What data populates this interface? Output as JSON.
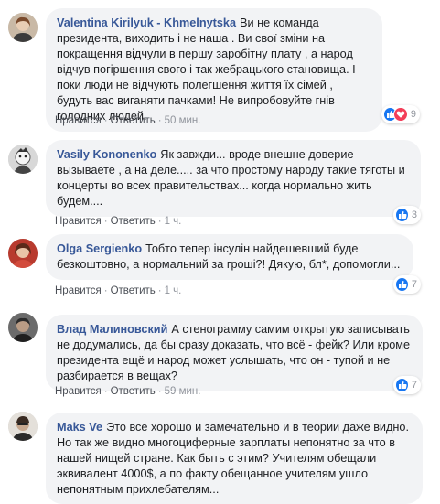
{
  "comments": [
    {
      "author": "Valentina Kirilyuk - Khmelnytska",
      "text": "Ви не команда президента, виходить і не наша . Ви свої зміни на покращення відчули в першу заробітну плату , а народ відчув погіршення свого і так жебрацького становища. І поки люди не відчують полегшення життя їх сімей , будуть вас виганяти пачками! Не випробовуйте гнів голодних людей.",
      "like_label": "Нравится",
      "reply_label": "Ответить",
      "time": "50 мин.",
      "reaction_count": "9",
      "reactions": [
        "like-icon",
        "love-icon"
      ]
    },
    {
      "author": "Vasily Kononenko",
      "text": "Як завжди... вроде внешне доверие вызываете , а на деле..... за что простому народу такие тяготы и концерты во всех правительствах... когда нормально жить будем....",
      "like_label": "Нравится",
      "reply_label": "Ответить",
      "time": "1 ч.",
      "reaction_count": "3",
      "reactions": [
        "like-icon"
      ]
    },
    {
      "author": "Olga Sergienko",
      "text": "Тобто тепер інсулін найдешевший буде безкоштовно, а нормальний за гроші?! Дякую, бл*, допомогли...",
      "like_label": "Нравится",
      "reply_label": "Ответить",
      "time": "1 ч.",
      "reaction_count": "7",
      "reactions": [
        "like-icon"
      ]
    },
    {
      "author": "Влад Малиновский",
      "text": "А стенограмму самим открытую записывать не додумались, да бы сразу доказать, что всё - фейк? Или кроме президента ещё и народ может услышать, что он - тупой и не разбирается в вещах?",
      "like_label": "Нравится",
      "reply_label": "Ответить",
      "time": "59 мин.",
      "reaction_count": "7",
      "reactions": [
        "like-icon"
      ]
    },
    {
      "author": "Maks Ve",
      "text": "Это все хорошо и замечательно и в теории даже видно. Но так же видно многоциферные зарплаты непонятно за что в нашей нищей стране. Как быть с этим? Учителям обещали эквивалент 4000$, а по факту обещанное учителям ушло непонятным прихлебателям...",
      "like_label": "",
      "reply_label": "",
      "time": "",
      "reaction_count": "",
      "reactions": []
    }
  ],
  "colors": {
    "author": "#385898",
    "bubble": "#f2f3f5",
    "like": "#1877f2",
    "love": "#f33e58"
  }
}
